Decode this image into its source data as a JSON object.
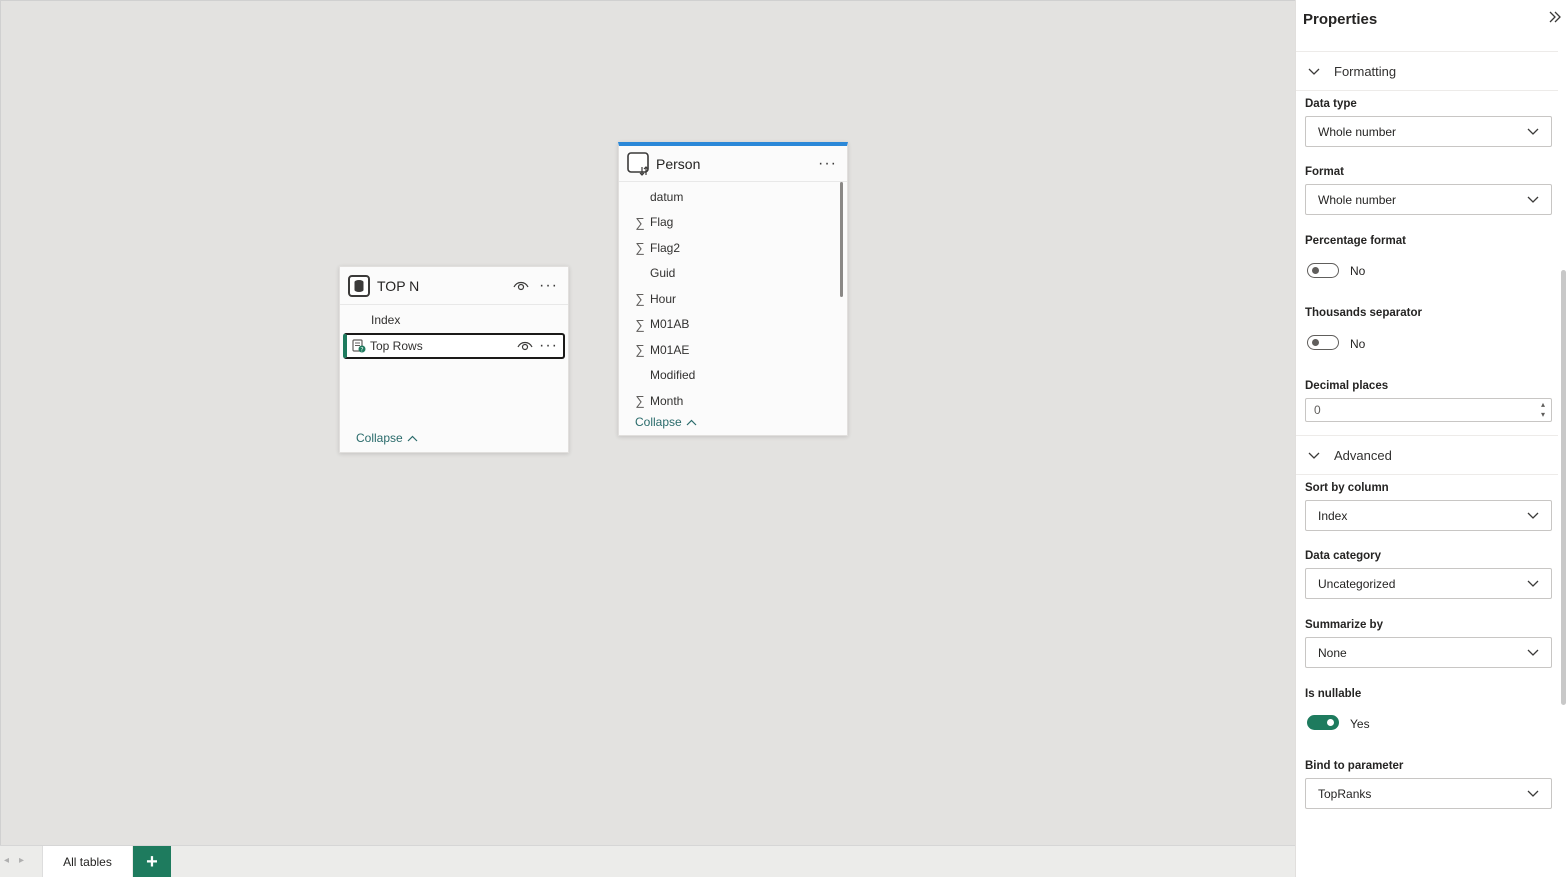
{
  "tables": {
    "topn": {
      "title": "TOP N",
      "fields": [
        {
          "name": "Index",
          "icon": ""
        },
        {
          "name": "Top Rows",
          "icon": "measure-param-icon",
          "selected": true
        }
      ],
      "collapse_label": "Collapse"
    },
    "person": {
      "title": "Person",
      "fields": [
        {
          "name": "datum",
          "sigma": ""
        },
        {
          "name": "Flag",
          "sigma": "∑"
        },
        {
          "name": "Flag2",
          "sigma": "∑"
        },
        {
          "name": "Guid",
          "sigma": ""
        },
        {
          "name": "Hour",
          "sigma": "∑"
        },
        {
          "name": "M01AB",
          "sigma": "∑"
        },
        {
          "name": "M01AE",
          "sigma": "∑"
        },
        {
          "name": "Modified",
          "sigma": ""
        },
        {
          "name": "Month",
          "sigma": "∑"
        }
      ],
      "collapse_label": "Collapse",
      "accent": "#2b88d8"
    }
  },
  "tabs": {
    "all_tables": "All tables",
    "add": "+"
  },
  "properties": {
    "title": "Properties",
    "formatting": {
      "section": "Formatting",
      "data_type_label": "Data type",
      "data_type_value": "Whole number",
      "format_label": "Format",
      "format_value": "Whole number",
      "percentage_label": "Percentage format",
      "percentage_value": "No",
      "thousands_label": "Thousands separator",
      "thousands_value": "No",
      "decimal_label": "Decimal places",
      "decimal_value": "0"
    },
    "advanced": {
      "section": "Advanced",
      "sort_label": "Sort by column",
      "sort_value": "Index",
      "category_label": "Data category",
      "category_value": "Uncategorized",
      "summarize_label": "Summarize by",
      "summarize_value": "None",
      "nullable_label": "Is nullable",
      "nullable_value": "Yes",
      "bind_label": "Bind to parameter",
      "bind_value": "TopRanks"
    }
  },
  "colors": {
    "accent_green": "#1e7b5e",
    "selection_border": "#1b1a19",
    "person_top_bar": "#2b88d8"
  }
}
